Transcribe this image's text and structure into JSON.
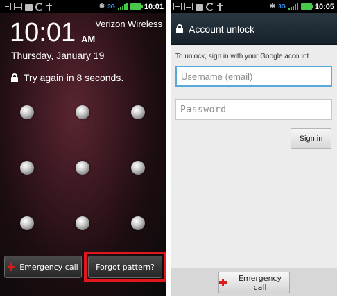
{
  "left": {
    "statusbar": {
      "time": "10:01",
      "network": "3G",
      "bt": "✱"
    },
    "clock": {
      "time": "10:01",
      "ampm": "AM"
    },
    "carrier": "Verizon Wireless",
    "date": "Thursday, January 19",
    "lock_message": "Try again in 8 seconds.",
    "emergency_label": "Emergency call",
    "forgot_label": "Forgot pattern?"
  },
  "right": {
    "statusbar": {
      "time": "10:05",
      "network": "3G",
      "bt": "✱"
    },
    "title": "Account unlock",
    "instruction": "To unlock, sign in with your Google account",
    "username_placeholder": "Username (email)",
    "password_placeholder": "Password",
    "sign_in_label": "Sign in",
    "emergency_label": "Emergency call"
  },
  "colors": {
    "highlight": "#e0181e",
    "emergency_cross": "#d81b1b",
    "focus_border": "#59a8da",
    "signal": "#49c94a",
    "network": "#3b9fff"
  }
}
